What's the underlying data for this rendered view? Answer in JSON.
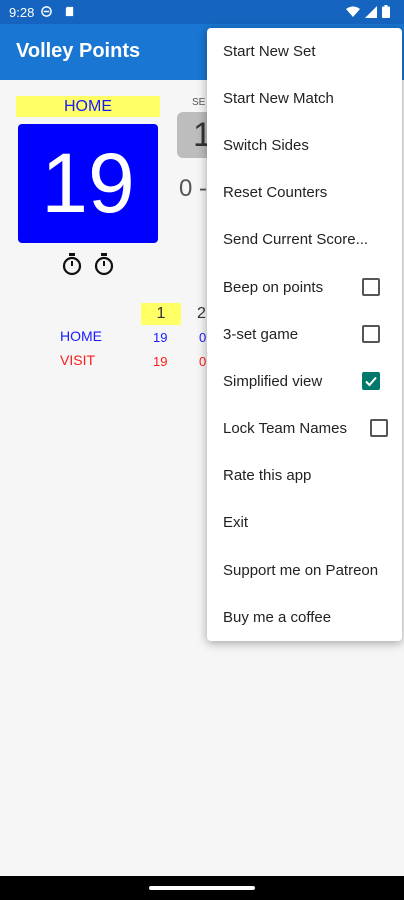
{
  "status_bar": {
    "time": "9:28"
  },
  "app_bar": {
    "title": "Volley Points"
  },
  "scoreboard": {
    "home_label": "HOME",
    "home_score": "19",
    "sets_label": "SE",
    "sets_value": "1",
    "sets_text": "0 -"
  },
  "set_table": {
    "headers": [
      "1",
      "2"
    ],
    "rows": [
      {
        "team": "HOME",
        "color": "#1a1aff",
        "values": [
          "19",
          "0"
        ]
      },
      {
        "team": "VISIT",
        "color": "#ff1a1a",
        "values": [
          "19",
          "0"
        ]
      }
    ]
  },
  "menu": {
    "items": [
      {
        "label": "Start New Set"
      },
      {
        "label": "Start New Match"
      },
      {
        "label": "Switch Sides"
      },
      {
        "label": "Reset Counters"
      },
      {
        "label": "Send Current Score..."
      },
      {
        "label": "Beep on points",
        "checked": false
      },
      {
        "label": "3-set game",
        "checked": false
      },
      {
        "label": "Simplified view",
        "checked": true
      },
      {
        "label": "Lock Team Names",
        "checked": false
      },
      {
        "label": "Rate this app"
      },
      {
        "label": "Exit"
      },
      {
        "label": "Support me on Patreon"
      },
      {
        "label": "Buy me a coffee"
      }
    ]
  },
  "colors": {
    "app_bar": "#1976d2",
    "status_bar": "#1565c0",
    "home_score_bg": "#0000ff",
    "label_highlight": "#ffff66",
    "checkbox_checked": "#00796b"
  }
}
